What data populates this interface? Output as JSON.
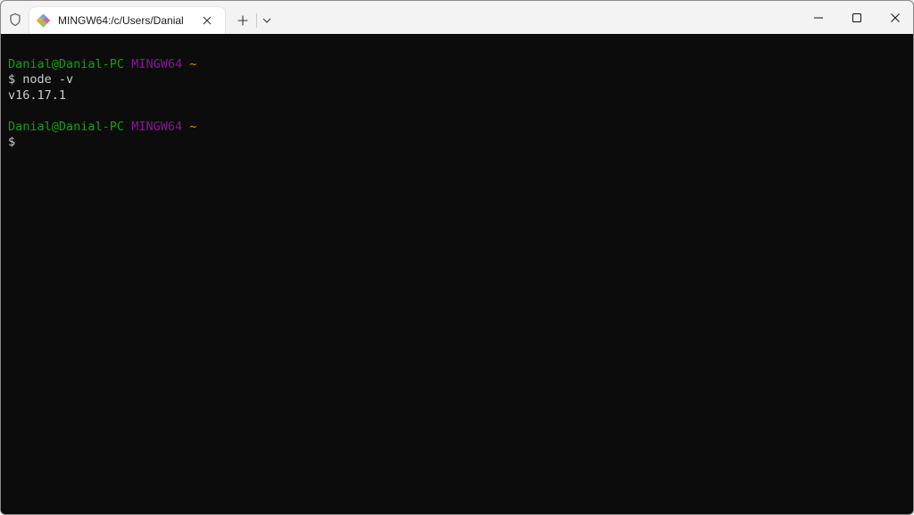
{
  "window": {
    "tab_title": "MINGW64:/c/Users/Danial",
    "icons": {
      "shield": "shield-icon",
      "tab": "git-bash-icon",
      "tab_close": "close-icon",
      "new_tab": "plus-icon",
      "dropdown": "chevron-down-icon",
      "minimize": "minimize-icon",
      "maximize": "maximize-icon",
      "close": "close-icon"
    }
  },
  "terminal": {
    "colors": {
      "background": "#0c0c0c",
      "user_host": "#13a10e",
      "env": "#881798",
      "path": "#c19c00",
      "text": "#cccccc"
    },
    "prompt1": {
      "user_host": "Danial@Danial-PC",
      "env": "MINGW64",
      "path": "~"
    },
    "command1": "$ node -v",
    "output1": "v16.17.1",
    "prompt2": {
      "user_host": "Danial@Danial-PC",
      "env": "MINGW64",
      "path": "~"
    },
    "command2": "$"
  }
}
